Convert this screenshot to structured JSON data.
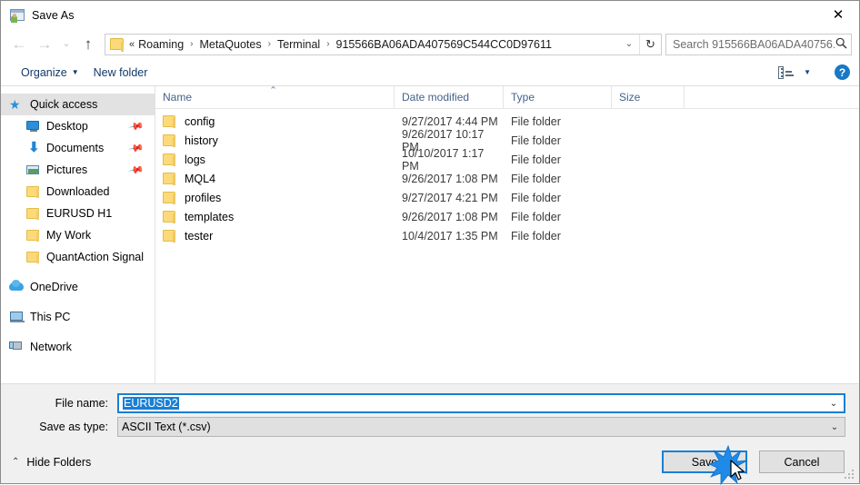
{
  "window": {
    "title": "Save As",
    "icon": "save-as-icon",
    "close_label": "✕"
  },
  "nav": {
    "back_icon": "←",
    "forward_icon": "→",
    "recent_icon": "⌄",
    "up_icon": "↑",
    "refresh_icon": "↻",
    "dropdown_icon": "⌄",
    "breadcrumb_prefix": "«",
    "breadcrumbs": [
      "Roaming",
      "MetaQuotes",
      "Terminal",
      "915566BA06ADA407569C544CC0D97611"
    ],
    "separator": "›"
  },
  "search": {
    "placeholder": "Search 915566BA06ADA40756...",
    "icon": "search-icon"
  },
  "toolbar": {
    "organize_label": "Organize",
    "organize_caret": "▼",
    "new_folder_label": "New folder",
    "view_caret": "▼",
    "help_label": "?"
  },
  "sidebar": {
    "items": [
      {
        "label": "Quick access",
        "icon": "star-icon",
        "selected": true,
        "indent": false,
        "pinned": false,
        "group": false
      },
      {
        "label": "Desktop",
        "icon": "monitor-icon",
        "selected": false,
        "indent": true,
        "pinned": true,
        "group": false
      },
      {
        "label": "Documents",
        "icon": "down-arrow-icon",
        "selected": false,
        "indent": true,
        "pinned": true,
        "group": false
      },
      {
        "label": "Pictures",
        "icon": "picture-icon",
        "selected": false,
        "indent": true,
        "pinned": true,
        "group": false
      },
      {
        "label": "Downloaded",
        "icon": "folder-icon",
        "selected": false,
        "indent": true,
        "pinned": false,
        "group": false
      },
      {
        "label": "EURUSD H1",
        "icon": "folder-icon",
        "selected": false,
        "indent": true,
        "pinned": false,
        "group": false
      },
      {
        "label": "My Work",
        "icon": "folder-icon",
        "selected": false,
        "indent": true,
        "pinned": false,
        "group": false
      },
      {
        "label": "QuantAction Signal",
        "icon": "folder-icon",
        "selected": false,
        "indent": true,
        "pinned": false,
        "group": false
      },
      {
        "label": "OneDrive",
        "icon": "cloud-icon",
        "selected": false,
        "indent": false,
        "pinned": false,
        "group": true
      },
      {
        "label": "This PC",
        "icon": "pc-icon",
        "selected": false,
        "indent": false,
        "pinned": false,
        "group": true
      },
      {
        "label": "Network",
        "icon": "network-icon",
        "selected": false,
        "indent": false,
        "pinned": false,
        "group": true
      }
    ],
    "pin_icon": "📌"
  },
  "filelist": {
    "columns": [
      "Name",
      "Date modified",
      "Type",
      "Size"
    ],
    "sort_caret": "⌃",
    "rows": [
      {
        "name": "config",
        "date": "9/27/2017 4:44 PM",
        "type": "File folder",
        "size": ""
      },
      {
        "name": "history",
        "date": "9/26/2017 10:17 PM",
        "type": "File folder",
        "size": ""
      },
      {
        "name": "logs",
        "date": "10/10/2017 1:17 PM",
        "type": "File folder",
        "size": ""
      },
      {
        "name": "MQL4",
        "date": "9/26/2017 1:08 PM",
        "type": "File folder",
        "size": ""
      },
      {
        "name": "profiles",
        "date": "9/27/2017 4:21 PM",
        "type": "File folder",
        "size": ""
      },
      {
        "name": "templates",
        "date": "9/26/2017 1:08 PM",
        "type": "File folder",
        "size": ""
      },
      {
        "name": "tester",
        "date": "10/4/2017 1:35 PM",
        "type": "File folder",
        "size": ""
      }
    ]
  },
  "form": {
    "filename_label": "File name:",
    "filename_value": "EURUSD2",
    "filetype_label": "Save as type:",
    "filetype_value": "ASCII Text (*.csv)",
    "dropdown_icon": "⌄"
  },
  "footer": {
    "hide_folders_label": "Hide Folders",
    "hide_folders_caret": "⌃",
    "save_label": "Save",
    "cancel_label": "Cancel"
  },
  "colors": {
    "accent": "#1a7fd4",
    "folder": "#fcd979",
    "crumb_text": "#1a1a1a",
    "column_header": "#44618a",
    "help_blue": "#1779c4"
  }
}
